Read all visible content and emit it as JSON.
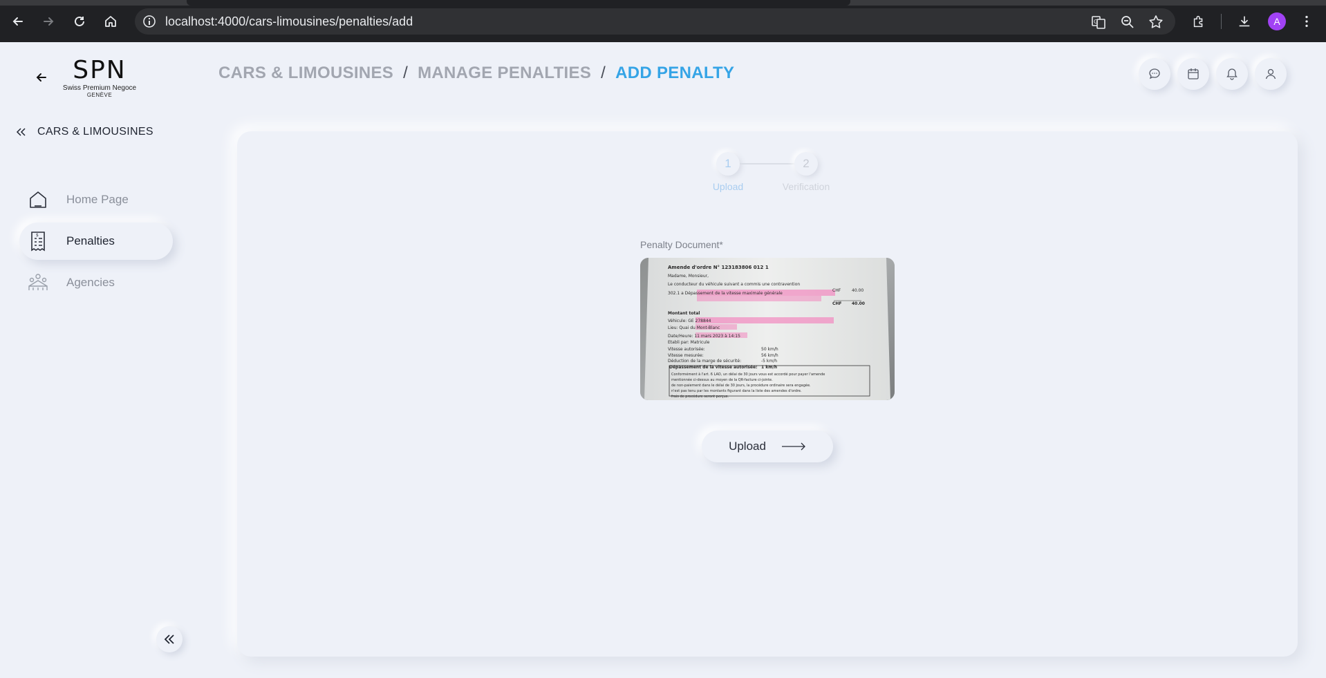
{
  "browser": {
    "url": "localhost:4000/cars-limousines/penalties/add",
    "avatar_letter": "A",
    "avatar_color": "#a142f4"
  },
  "logo": {
    "mark": "SPN",
    "line1": "Swiss Premium Negoce",
    "line2": "GENÈVE"
  },
  "sidebar": {
    "section_label": "CARS & LIMOUSINES",
    "items": [
      {
        "label": "Home Page",
        "icon": "home-icon"
      },
      {
        "label": "Penalties",
        "icon": "invoice-icon",
        "active": true
      },
      {
        "label": "Agencies",
        "icon": "agencies-icon"
      }
    ]
  },
  "breadcrumb": {
    "items": [
      "CARS & LIMOUSINES",
      "MANAGE PENALTIES",
      "ADD PENALTY"
    ],
    "separator": "/",
    "active_color": "#35a4e6"
  },
  "header_icons": [
    "chat-icon",
    "calendar-icon",
    "bell-icon",
    "user-icon"
  ],
  "stepper": {
    "steps": [
      {
        "number": "1",
        "label": "Upload"
      },
      {
        "number": "2",
        "label": "Verification"
      }
    ],
    "current": 1
  },
  "form": {
    "document_label": "Penalty Document",
    "required_mark": "*",
    "preview_lines": [
      "Amende d'ordre N° 123183806 012 1",
      "Madame, Monsieur,",
      "Le conducteur du véhicule suivant a commis une contravention",
      "302.1 a Dépassement de la vitesse maximale générale",
      "Montant total",
      "Véhicule: GE 278844",
      "Lieu: Quai du Mont-Blanc",
      "Date/Heure: 11 mars 2023 à 14:15",
      "Etabli par: Matricule",
      "Vitesse autorisée:",
      "Vitesse mesurée:",
      "Déduction de la marge de sécurité:",
      "Dépassement de la vitesse autorisée:",
      "Conformément à l'art. 6 LAO, un délai de 30 jours vous est accordé pour payer l'amende",
      "mentionnée ci-dessus au moyen de la QR-facture ci-jointe.",
      "de non-paiement dans le délai de 30 jours, la procédure ordinaire sera engagée.",
      "n'est pas tenu par les montants figurant dans la liste des amendes d'ordre.",
      "frais de procédure seront perçus."
    ],
    "preview_values": {
      "chf_label": "CHF",
      "amount": "40.00",
      "total": "40.00",
      "speed_allowed": "50 km/h",
      "speed_measured": "56 km/h",
      "deduction": "-5 km/h",
      "excess": "1 km/h"
    },
    "upload_button": "Upload"
  }
}
